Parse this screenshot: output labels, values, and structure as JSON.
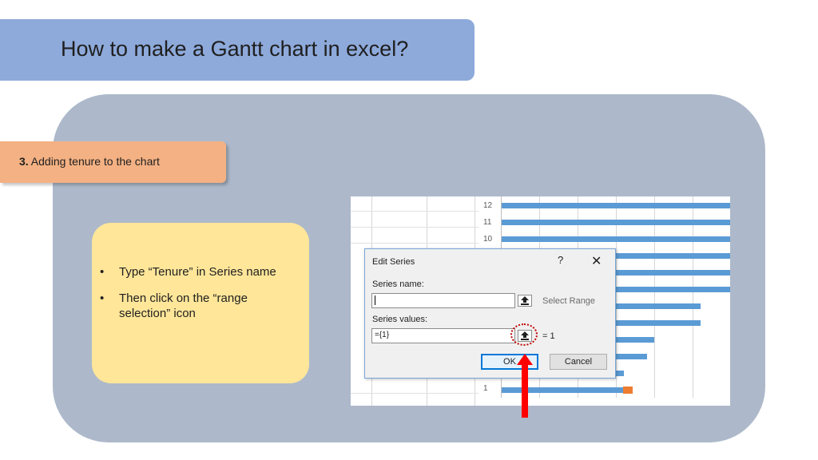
{
  "slide": {
    "title": "How to make a Gantt chart in excel?",
    "step_number": "3.",
    "step_text": " Adding tenure to the chart",
    "bullets": [
      "Type “Tenure” in Series name",
      "Then click on the “range selection” icon"
    ],
    "bullet_glyph": "•"
  },
  "chart": {
    "categories": [
      "12",
      "11",
      "10",
      "1"
    ],
    "bar_color": "#5b9bd5",
    "tenure_color": "#ed7d31"
  },
  "dialog": {
    "title": "Edit Series",
    "help": "?",
    "close": "✕",
    "series_name_label": "Series name:",
    "series_name_value": "",
    "select_range": "Select Range",
    "series_values_label": "Series values:",
    "series_values_value": "={1}",
    "values_result": "= 1",
    "ok": "OK",
    "cancel": "Cancel"
  },
  "colors": {
    "title_banner": "#8eaadb",
    "panel": "#adb9ca",
    "step_tag": "#f4b183",
    "note": "#ffe699",
    "highlight": "#c00000",
    "arrow": "#ff0000"
  }
}
